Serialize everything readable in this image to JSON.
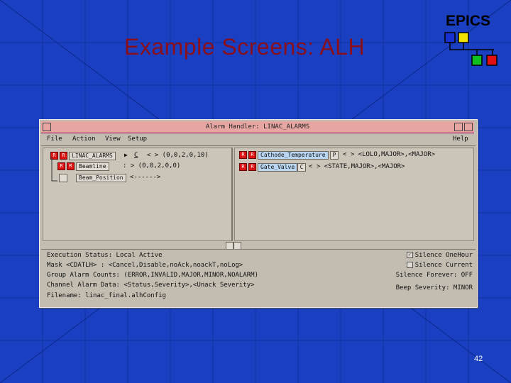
{
  "slide": {
    "title": "Example Screens: ALH",
    "logo_text": "EPICS",
    "page_number": "42",
    "colors": {
      "background": "#1a3fc0",
      "title": "#8a0f1c"
    }
  },
  "window": {
    "title": "Alarm Handler: LINAC_ALARMS",
    "menus": {
      "file": "File",
      "action": "Action",
      "view": "View",
      "setup": "Setup",
      "help": "Help"
    }
  },
  "tree": {
    "rows": [
      {
        "ack1": "R",
        "ack2": "R",
        "name": "LINAC_ALARMS",
        "arrow": "▶",
        "btn": "C",
        "text": "<        > (0,0,2,0,10)"
      },
      {
        "ack1": "R",
        "ack2": "R",
        "name": "Beamline",
        "arrow": "",
        "btn": "",
        "text": ":        > (0,0,2,0,0)"
      },
      {
        "ack1": "",
        "ack2": "",
        "name": "Beam_Position",
        "arrow": "",
        "btn": "",
        "text": "<------>"
      }
    ]
  },
  "group": {
    "rows": [
      {
        "ack1": "R",
        "ack2": "R",
        "name": "Cathode_Temperature",
        "btn": "P",
        "text": "<     > <LOLO,MAJOR>,<MAJOR>"
      },
      {
        "ack1": "R",
        "ack2": "R",
        "name": "Gate_Valve",
        "btn": "C",
        "text": "<           > <STATE,MAJOR>,<MAJOR>"
      }
    ]
  },
  "status": {
    "execution": "Execution Status:  Local Active",
    "mask": "Mask <CDATLH> : <Cancel,Disable,noAck,noackT,noLog>",
    "group_counts": "Group Alarm Counts: (ERROR,INVALID,MAJOR,MINOR,NOALARM)",
    "channel_data": "Channel Alarm Data: <Status,Severity>,<Unack Severity>",
    "filename": "Filename:  linac_final.alhConfig",
    "silence_oneHour": "Silence OneHour",
    "silence_current": "Silence Current",
    "silence_forever": "Silence Forever:   OFF",
    "beep_severity": "Beep Severity:   MINOR"
  }
}
